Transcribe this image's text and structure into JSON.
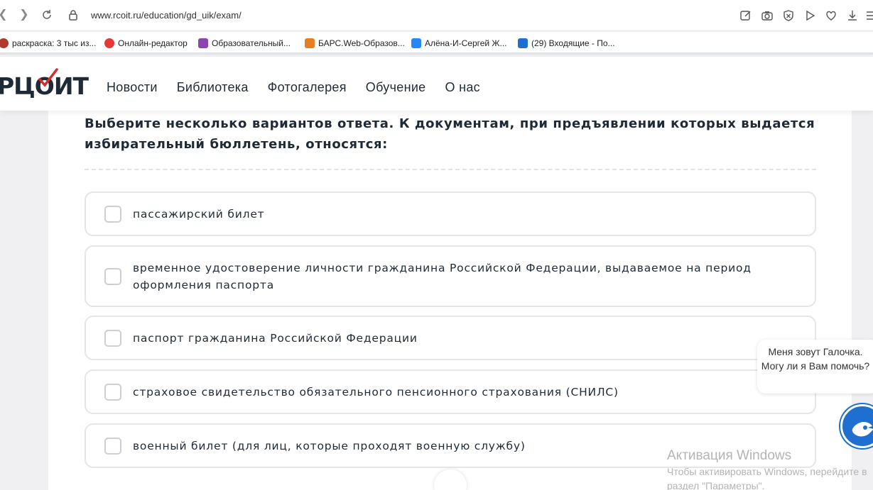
{
  "browser": {
    "url": "www.rcoit.ru/education/gd_uik/exam/",
    "bookmarks": [
      {
        "label": "раскраска: 3 тыс из...",
        "color": "#c0392b"
      },
      {
        "label": "Онлайн-редактор",
        "color": "#e53935"
      },
      {
        "label": "Образовательный...",
        "color": "#8e44ad"
      },
      {
        "label": "БАРС.Web-Образов...",
        "color": "#e67e22"
      },
      {
        "label": "Алёна-И-Сергей Ж...",
        "color": "#2787f5"
      },
      {
        "label": "(29) Входящие - По...",
        "color": "#1e6fd0"
      }
    ]
  },
  "site": {
    "logo": "РЦОИТ",
    "nav": [
      "Новости",
      "Библиотека",
      "Фотогалерея",
      "Обучение",
      "О нас"
    ]
  },
  "exam": {
    "question": "Выберите несколько вариантов ответа. К документам, при предъявлении которых выдается избирательный бюллетень, относятся:",
    "options": [
      "пассажирский билет",
      "временное удостоверение личности гражданина Российской Федерации, выдаваемое на период оформления паспорта",
      "паспорт гражданина Российской Федерации",
      "страховое свидетельство обязательного пенсионного страхования (СНИЛС)",
      "военный билет (для лиц, которые проходят военную службу)"
    ]
  },
  "chat": {
    "message": "Меня зовут Галочка. Могу ли я Вам помочь?"
  },
  "watermark": {
    "title": "Активация Windows",
    "line1": "Чтобы активировать Windows, перейдите в",
    "line2": "раздел \"Параметры\"."
  }
}
